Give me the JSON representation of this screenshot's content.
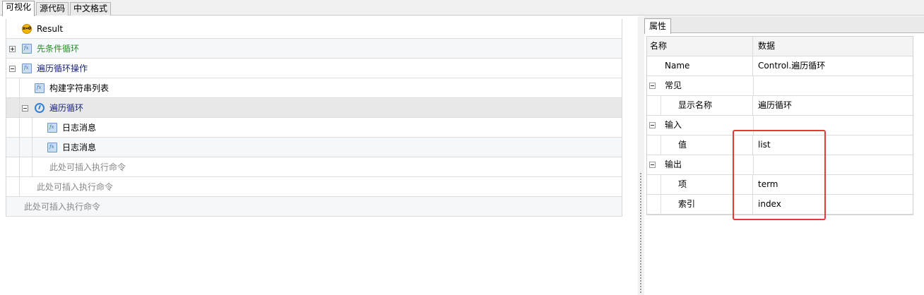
{
  "top_tabs": [
    {
      "label": "可视化",
      "active": true
    },
    {
      "label": "源代码",
      "active": false
    },
    {
      "label": "中文格式",
      "active": false
    }
  ],
  "tree": {
    "result": "Result",
    "pre_condition_loop": "先条件循环",
    "traverse_loop_op": "遍历循环操作",
    "build_string_list": "构建字符串列表",
    "traverse_loop": "遍历循环",
    "log_message_1": "日志消息",
    "log_message_2": "日志消息",
    "insert_hint_inner": "此处可插入执行命令",
    "insert_hint_mid": "此处可插入执行命令",
    "insert_hint_outer": "此处可插入执行命令"
  },
  "properties": {
    "tab_label": "属性",
    "col_name": "名称",
    "col_data": "数据",
    "name_label": "Name",
    "name_value": "Control.遍历循环",
    "cat_common": "常见",
    "display_name_label": "显示名称",
    "display_name_value": "遍历循环",
    "cat_input": "输入",
    "value_label": "值",
    "value_value": "list",
    "cat_output": "输出",
    "item_label": "项",
    "item_value": "term",
    "index_label": "索引",
    "index_value": "index"
  },
  "colors": {
    "highlight": "#e53935",
    "green_text": "#2e8b2e",
    "navy_text": "#1a237e"
  }
}
